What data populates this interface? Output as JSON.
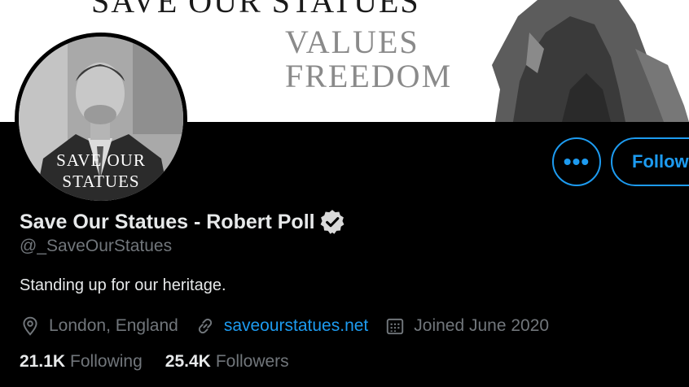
{
  "banner": {
    "line1": "Save Our Statues",
    "line2": "Values",
    "line3": "Freedom"
  },
  "avatar": {
    "caption_line1": "Save Our",
    "caption_line2": "Statues"
  },
  "actions": {
    "more_label": "•••",
    "follow_label": "Follow"
  },
  "profile": {
    "display_name": "Save Our Statues - Robert Poll",
    "handle": "@_SaveOurStatues",
    "bio": "Standing up for our heritage.",
    "location": "London, England",
    "website": "saveourstatues.net",
    "joined": "Joined June 2020"
  },
  "stats": {
    "following_count": "21.1K",
    "following_label": "Following",
    "followers_count": "25.4K",
    "followers_label": "Followers"
  },
  "colors": {
    "accent": "#1d9bf0",
    "background": "#000000",
    "secondary_text": "#71767b",
    "primary_text": "#e7e9ea"
  },
  "icons": {
    "location": "location-pin-icon",
    "link": "link-icon",
    "calendar": "calendar-icon",
    "verified": "verified-badge-icon"
  }
}
